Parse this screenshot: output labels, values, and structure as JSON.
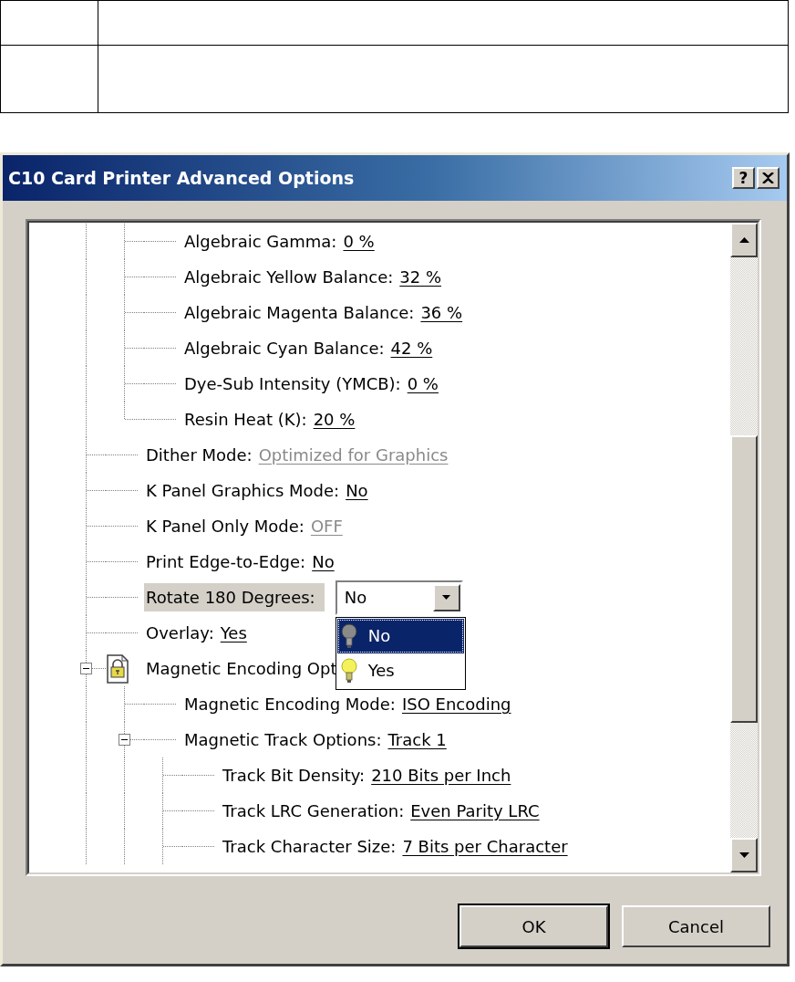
{
  "document_table": {
    "rows": [
      {
        "cells": [
          {
            "kind": "blank"
          },
          {
            "kind": "blank"
          }
        ]
      },
      {
        "cells": [
          {
            "kind": "blank"
          },
          {
            "kind": "blank"
          }
        ]
      }
    ]
  },
  "dialog": {
    "title": "C10 Card Printer Advanced Options",
    "help_button": "?",
    "tree": [
      {
        "kind": "clipped",
        "children": [
          {
            "kind": "setting",
            "label": "Algebraic Gamma:",
            "value": "0 %",
            "disabled": false
          },
          {
            "kind": "setting",
            "label": "Algebraic Yellow Balance:",
            "value": "32 %",
            "disabled": false
          },
          {
            "kind": "setting",
            "label": "Algebraic Magenta Balance:",
            "value": "36 %",
            "disabled": false
          },
          {
            "kind": "setting",
            "label": "Algebraic Cyan Balance:",
            "value": "42 %",
            "disabled": false
          },
          {
            "kind": "setting",
            "label": "Dye-Sub Intensity (YMCB):",
            "value": "0 %",
            "disabled": false
          },
          {
            "kind": "setting",
            "label": "Resin Heat (K):",
            "value": "20 %",
            "disabled": false
          }
        ]
      },
      {
        "kind": "setting",
        "label": "Dither Mode:",
        "value": "Optimized for Graphics",
        "disabled": true
      },
      {
        "kind": "setting",
        "label": "K Panel Graphics Mode:",
        "value": "No",
        "disabled": false
      },
      {
        "kind": "setting",
        "label": "K Panel Only Mode:",
        "value": "OFF",
        "disabled": true
      },
      {
        "kind": "setting",
        "label": "Print Edge-to-Edge:",
        "value": "No",
        "disabled": false
      },
      {
        "kind": "combo",
        "label": "Rotate 180 Degrees:",
        "value": "No",
        "expanded": true,
        "options": [
          {
            "label": "No",
            "selected": true,
            "lit": false
          },
          {
            "label": "Yes",
            "selected": false,
            "lit": true
          }
        ]
      },
      {
        "kind": "setting",
        "label": "Overlay:",
        "value": "Yes",
        "disabled": false
      },
      {
        "kind": "group",
        "label": "Magnetic Encoding Opt",
        "expanded": true,
        "children": [
          {
            "kind": "setting",
            "label": "Magnetic Encoding Mode:",
            "value": "ISO Encoding",
            "disabled": false
          },
          {
            "kind": "setting",
            "label": "Magnetic Track Options:",
            "value": "Track 1",
            "disabled": false,
            "expanded": true,
            "children": [
              {
                "kind": "setting",
                "label": "Track Bit Density:",
                "value": "210 Bits per Inch",
                "disabled": false
              },
              {
                "kind": "setting",
                "label": "Track LRC Generation:",
                "value": "Even Parity LRC",
                "disabled": false
              },
              {
                "kind": "setting",
                "label": "Track Character Size:",
                "value": "7 Bits per Character",
                "disabled": false
              }
            ]
          }
        ]
      }
    ],
    "buttons": [
      {
        "label": "OK",
        "default": true
      },
      {
        "label": "Cancel",
        "default": false
      }
    ]
  }
}
